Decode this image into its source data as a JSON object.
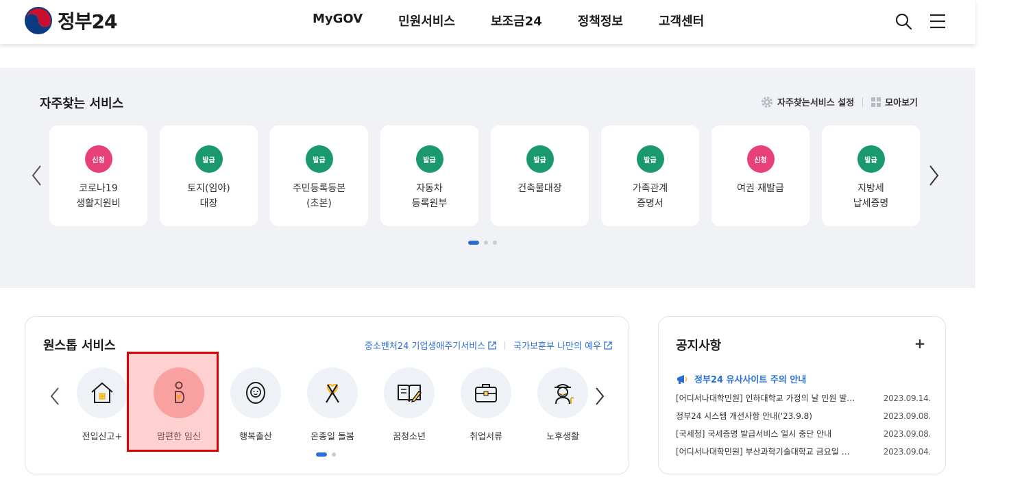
{
  "header": {
    "logo_text": "정부24",
    "nav": [
      "MyGOV",
      "민원서비스",
      "보조금24",
      "정책정보",
      "고객센터"
    ]
  },
  "frequent": {
    "title": "자주찾는 서비스",
    "settings_label": "자주찾는서비스 설정",
    "collect_label": "모아보기",
    "cards": [
      {
        "badge": "신청",
        "label": "코로나19\n생활지원비",
        "color": "#e8417a"
      },
      {
        "badge": "발급",
        "label": "토지(임야)\n대장",
        "color": "#1a9a6c"
      },
      {
        "badge": "발급",
        "label": "주민등록등본\n(초본)",
        "color": "#1a9a6c"
      },
      {
        "badge": "발급",
        "label": "자동차\n등록원부",
        "color": "#1a9a6c"
      },
      {
        "badge": "발급",
        "label": "건축물대장",
        "color": "#1a9a6c"
      },
      {
        "badge": "발급",
        "label": "가족관계\n증명서",
        "color": "#1a9a6c"
      },
      {
        "badge": "신청",
        "label": "여권 재발급",
        "color": "#e8417a"
      },
      {
        "badge": "발급",
        "label": "지방세\n납세증명",
        "color": "#1a9a6c"
      }
    ]
  },
  "onestop": {
    "title": "원스톱 서비스",
    "links": [
      "중소벤처24 기업생애주기서비스",
      "국가보훈부 나만의 예우"
    ],
    "items": [
      {
        "label": "전입신고+",
        "icon": "house-icon"
      },
      {
        "label": "맘편한 임신",
        "icon": "pregnancy-icon"
      },
      {
        "label": "행복출산",
        "icon": "baby-icon"
      },
      {
        "label": "온종일 돌봄",
        "icon": "ribbon-heart-icon"
      },
      {
        "label": "꿈청소년",
        "icon": "book-pencil-icon"
      },
      {
        "label": "취업서류",
        "icon": "briefcase-icon"
      },
      {
        "label": "노후생활",
        "icon": "elder-icon"
      }
    ]
  },
  "notice": {
    "title": "공지사항",
    "more": "+",
    "pinned": "정부24 유사사이트 주의 안내",
    "items": [
      {
        "title": "[어디서나대학민원] 인하대학교 가정의 날 민원 발…",
        "date": "2023.09.14."
      },
      {
        "title": "정부24 시스템 개선사항 안내('23.9.8)",
        "date": "2023.09.08."
      },
      {
        "title": "[국세청] 국세증명 발급서비스 일시 중단 안내",
        "date": "2023.09.08."
      },
      {
        "title": "[어디서나대학민원] 부산과학기술대학교 금요일 …",
        "date": "2023.09.04."
      }
    ]
  }
}
